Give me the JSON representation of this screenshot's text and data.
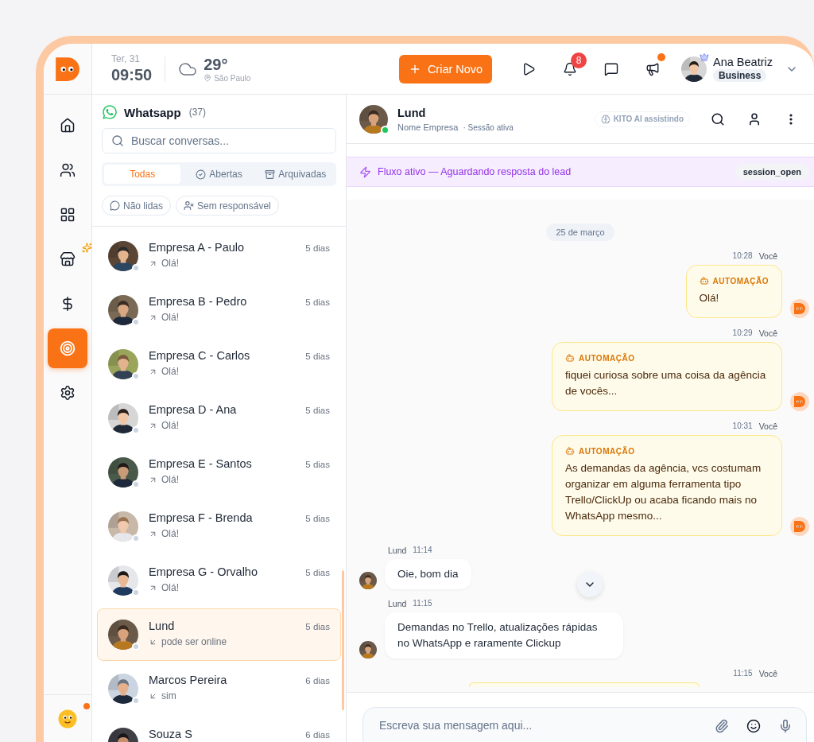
{
  "header": {
    "date": "Ter, 31",
    "time": "09:50",
    "temperature": "29°",
    "city": "São Paulo",
    "create_button": "Criar Novo",
    "notification_count": "8",
    "announcement_unread": true,
    "user": {
      "name": "Ana Beatriz",
      "plan": "Business",
      "premium": true
    }
  },
  "sidebar": {
    "profile_unread": true,
    "items": [
      {
        "kind": "home",
        "selected": false,
        "new": false
      },
      {
        "kind": "users",
        "selected": false,
        "new": false
      },
      {
        "kind": "apps",
        "selected": false,
        "new": false
      },
      {
        "kind": "store",
        "selected": false,
        "new": true
      },
      {
        "kind": "money",
        "selected": false,
        "new": false
      },
      {
        "kind": "target",
        "selected": true,
        "new": false
      },
      {
        "kind": "settings",
        "selected": false,
        "new": false
      }
    ]
  },
  "conversations": {
    "title": "Whatsapp",
    "count": "(37)",
    "search_placeholder": "Buscar conversas...",
    "tabs": [
      {
        "kind": "all",
        "label": "Todas",
        "selected": true
      },
      {
        "kind": "open",
        "label": "Abertas",
        "selected": false
      },
      {
        "kind": "archived",
        "label": "Arquivadas",
        "selected": false
      }
    ],
    "filters": [
      {
        "kind": "unread",
        "label": "Não lidas"
      },
      {
        "kind": "unassigned",
        "label": "Sem responsável"
      }
    ],
    "items": [
      {
        "name": "Empresa A - Paulo",
        "time": "5 dias",
        "kind": "sent",
        "preview": "Olá!",
        "online": false,
        "selected": false
      },
      {
        "name": "Empresa B - Pedro",
        "time": "5 dias",
        "kind": "sent",
        "preview": "Olá!",
        "online": false,
        "selected": false
      },
      {
        "name": "Empresa C - Carlos",
        "time": "5 dias",
        "kind": "sent",
        "preview": "Olá!",
        "online": false,
        "selected": false
      },
      {
        "name": "Empresa D - Ana",
        "time": "5 dias",
        "kind": "sent",
        "preview": "Olá!",
        "online": false,
        "selected": false
      },
      {
        "name": "Empresa E - Santos",
        "time": "5 dias",
        "kind": "sent",
        "preview": "Olá!",
        "online": false,
        "selected": false
      },
      {
        "name": "Empresa F - Brenda",
        "time": "5 dias",
        "kind": "sent",
        "preview": "Olá!",
        "online": false,
        "selected": false
      },
      {
        "name": "Empresa G - Orvalho",
        "time": "5 dias",
        "kind": "sent",
        "preview": "Olá!",
        "online": false,
        "selected": false
      },
      {
        "name": "Lund",
        "time": "5 dias",
        "kind": "received",
        "preview": "pode ser online",
        "online": false,
        "selected": true
      },
      {
        "name": "Marcos Pereira",
        "time": "6 dias",
        "kind": "received",
        "preview": "sim",
        "online": false,
        "selected": false
      },
      {
        "name": "Souza S",
        "time": "6 dias",
        "selected": false
      }
    ]
  },
  "chat": {
    "contact": {
      "name": "Lund",
      "company": "Nome Empresa",
      "status": "· Sessão ativa",
      "online": true
    },
    "ai_badge": "KITO AI assistindo",
    "banner": {
      "text": "Fluxo ativo — Aguardando resposta do lead",
      "tag": "session_open"
    },
    "date": "25 de março",
    "messages": [
      {
        "kind": "bot",
        "time": "10:28",
        "author": "Você",
        "label": "AUTOMAÇÃO",
        "text": "Olá!"
      },
      {
        "kind": "bot",
        "time": "10:29",
        "author": "Você",
        "label": "AUTOMAÇÃO",
        "text": "fiquei curiosa sobre uma coisa da agência de vocês..."
      },
      {
        "kind": "bot",
        "time": "10:31",
        "author": "Você",
        "label": "AUTOMAÇÃO",
        "text": "As demandas da agência, vcs costumam organizar em alguma ferramenta tipo Trello/ClickUp ou acaba ficando mais no WhatsApp mesmo..."
      },
      {
        "kind": "contact",
        "author": "Lund",
        "time": "11:14",
        "text": "Oie, bom dia"
      },
      {
        "kind": "contact",
        "author": "Lund",
        "time": "11:15",
        "text": "Demandas no Trello, atualizações rápidas no WhatsApp e raramente Clickup"
      },
      {
        "kind": "cut",
        "time": "11:15",
        "author": "Você"
      }
    ],
    "composer_placeholder": "Escreva sua mensagem aqui..."
  }
}
